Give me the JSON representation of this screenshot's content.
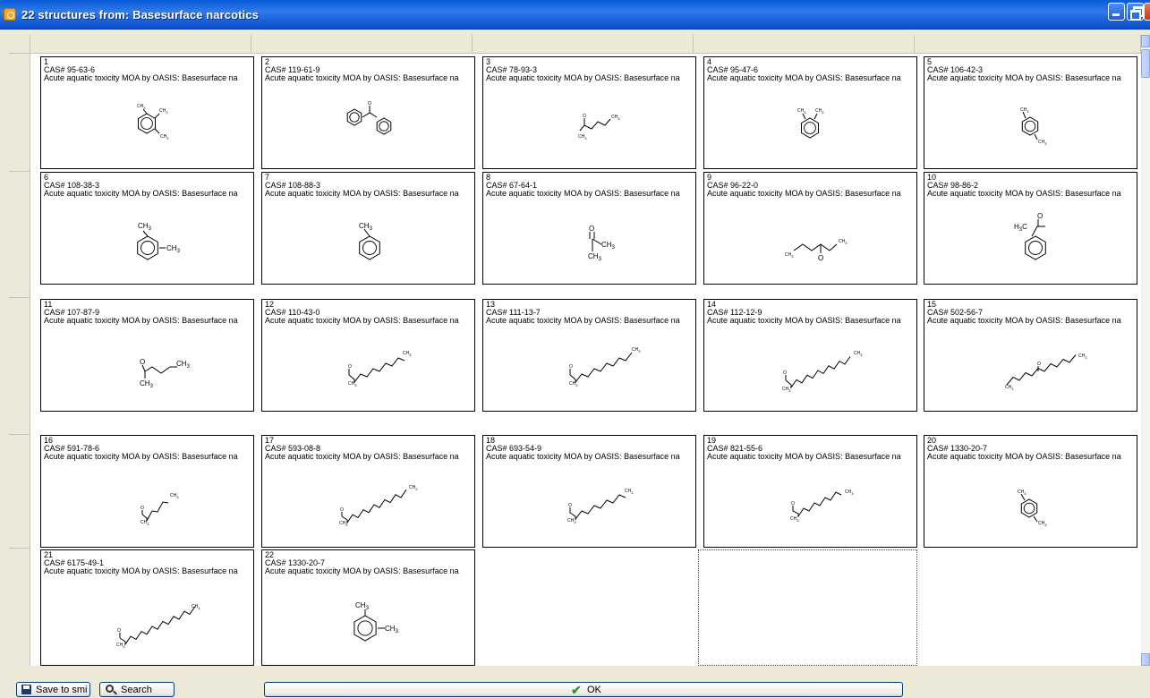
{
  "window": {
    "title": "22 structures from: Basesurface narcotics"
  },
  "cards": [
    {
      "num": "1",
      "cas": "CAS# 95-63-6",
      "desc": "Acute aquatic toxicity MOA by OASIS: Basesurface na",
      "mol": "m1"
    },
    {
      "num": "2",
      "cas": "CAS# 119-61-9",
      "desc": "Acute aquatic toxicity MOA by OASIS: Basesurface na",
      "mol": "m2"
    },
    {
      "num": "3",
      "cas": "CAS# 78-93-3",
      "desc": "Acute aquatic toxicity MOA by OASIS: Basesurface na",
      "mol": "m3"
    },
    {
      "num": "4",
      "cas": "CAS# 95-47-6",
      "desc": "Acute aquatic toxicity MOA by OASIS: Basesurface na",
      "mol": "m4"
    },
    {
      "num": "5",
      "cas": "CAS# 106-42-3",
      "desc": "Acute aquatic toxicity MOA by OASIS: Basesurface na",
      "mol": "m5"
    },
    {
      "num": "6",
      "cas": "CAS# 108-38-3",
      "desc": "Acute aquatic toxicity MOA by OASIS: Basesurface na",
      "mol": "m6"
    },
    {
      "num": "7",
      "cas": "CAS# 108-88-3",
      "desc": "Acute aquatic toxicity MOA by OASIS: Basesurface na",
      "mol": "m7"
    },
    {
      "num": "8",
      "cas": "CAS# 67-64-1",
      "desc": "Acute aquatic toxicity MOA by OASIS: Basesurface na",
      "mol": "m8"
    },
    {
      "num": "9",
      "cas": "CAS# 96-22-0",
      "desc": "Acute aquatic toxicity MOA by OASIS: Basesurface na",
      "mol": "m9"
    },
    {
      "num": "10",
      "cas": "CAS# 98-86-2",
      "desc": "Acute aquatic toxicity MOA by OASIS: Basesurface na",
      "mol": "m10"
    },
    {
      "num": "11",
      "cas": "CAS# 107-87-9",
      "desc": "Acute aquatic toxicity MOA by OASIS: Basesurface na",
      "mol": "m11"
    },
    {
      "num": "12",
      "cas": "CAS# 110-43-0",
      "desc": "Acute aquatic toxicity MOA by OASIS: Basesurface na",
      "mol": "m12"
    },
    {
      "num": "13",
      "cas": "CAS# 111-13-7",
      "desc": "Acute aquatic toxicity MOA by OASIS: Basesurface na",
      "mol": "m13"
    },
    {
      "num": "14",
      "cas": "CAS# 112-12-9",
      "desc": "Acute aquatic toxicity MOA by OASIS: Basesurface na",
      "mol": "m14"
    },
    {
      "num": "15",
      "cas": "CAS# 502-56-7",
      "desc": "Acute aquatic toxicity MOA by OASIS: Basesurface na",
      "mol": "m15"
    },
    {
      "num": "16",
      "cas": "CAS# 591-78-6",
      "desc": "Acute aquatic toxicity MOA by OASIS: Basesurface na",
      "mol": "m16"
    },
    {
      "num": "17",
      "cas": "CAS# 593-08-8",
      "desc": "Acute aquatic toxicity MOA by OASIS: Basesurface na",
      "mol": "m17"
    },
    {
      "num": "18",
      "cas": "CAS# 693-54-9",
      "desc": "Acute aquatic toxicity MOA by OASIS: Basesurface na",
      "mol": "m18"
    },
    {
      "num": "19",
      "cas": "CAS# 821-55-6",
      "desc": "Acute aquatic toxicity MOA by OASIS: Basesurface na",
      "mol": "m19"
    },
    {
      "num": "20",
      "cas": "CAS# 1330-20-7",
      "desc": "Acute aquatic toxicity MOA by OASIS: Basesurface na",
      "mol": "m20"
    },
    {
      "num": "21",
      "cas": "CAS# 6175-49-1",
      "desc": "Acute aquatic toxicity MOA by OASIS: Basesurface na",
      "mol": "m21"
    },
    {
      "num": "22",
      "cas": "CAS# 1330-20-7",
      "desc": "Acute aquatic toxicity MOA by OASIS: Basesurface na",
      "mol": "m22"
    }
  ],
  "atom_labels": {
    "methyl": "CH",
    "methyl_sub": "3",
    "methyl_left": "H",
    "methyl_left_rest": "C",
    "oxygen": "O"
  },
  "buttons": {
    "save_label": "Save to smi",
    "search_label": "Search",
    "ok_label": "OK"
  },
  "icons": {
    "save": "floppy-disk-icon",
    "search": "magnifier-icon",
    "ok": "checkmark-icon"
  },
  "colors": {
    "titlebar": "#1C62DA",
    "window_bg": "#ECE9D8",
    "ok_check": "#2E9A2E"
  }
}
